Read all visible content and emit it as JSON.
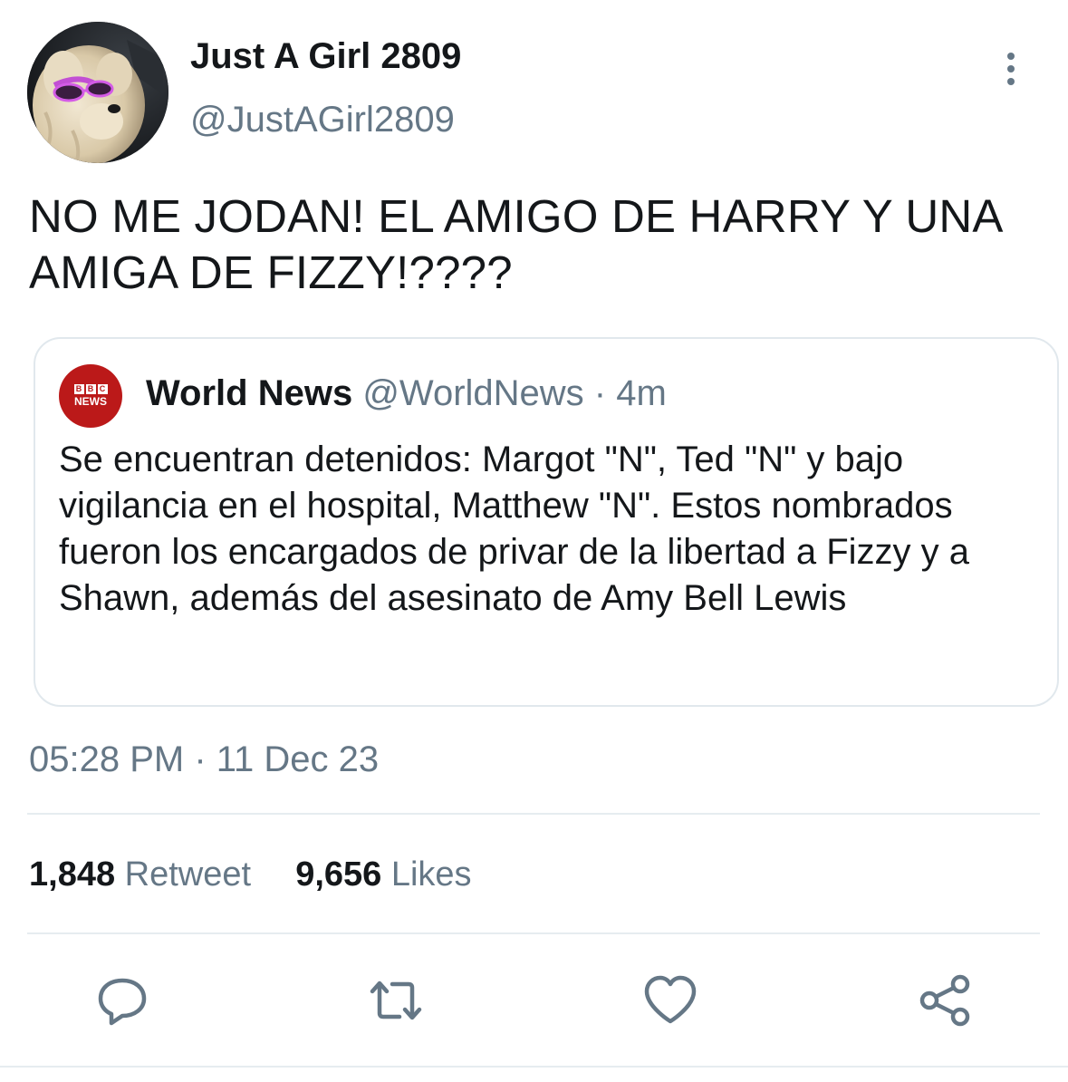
{
  "tweet": {
    "author": {
      "display_name": "Just A Girl 2809",
      "handle": "@JustAGirl2809",
      "avatar_icon": "dog-with-sunglasses-avatar"
    },
    "text": "NO ME JODAN! EL AMIGO DE HARRY Y UNA AMIGA DE FIZZY!????",
    "quoted": {
      "avatar_icon": "bbc-news-logo",
      "logo_blocks": [
        "B",
        "B",
        "C"
      ],
      "logo_word": "NEWS",
      "name": "World News",
      "handle": "@WorldNews",
      "separator": "·",
      "time": "4m",
      "text": "Se encuentran detenidos: Margot \"N\", Ted \"N\" y bajo vigilancia en el hospital, Matthew \"N\". Estos nombrados fueron los encargados de privar de la libertad a Fizzy y a Shawn, además del asesinato de Amy Bell Lewis"
    },
    "timestamp": "05:28 PM · 11 Dec 23",
    "stats": {
      "retweets_count": "1,848",
      "retweets_label": "Retweet",
      "likes_count": "9,656",
      "likes_label": "Likes"
    },
    "actions": [
      "reply-icon",
      "retweet-icon",
      "like-icon",
      "share-icon"
    ]
  },
  "colors": {
    "text_primary": "#14171a",
    "text_secondary": "#657786",
    "border": "#e1e8ed",
    "bbc_red": "#bb1919"
  }
}
